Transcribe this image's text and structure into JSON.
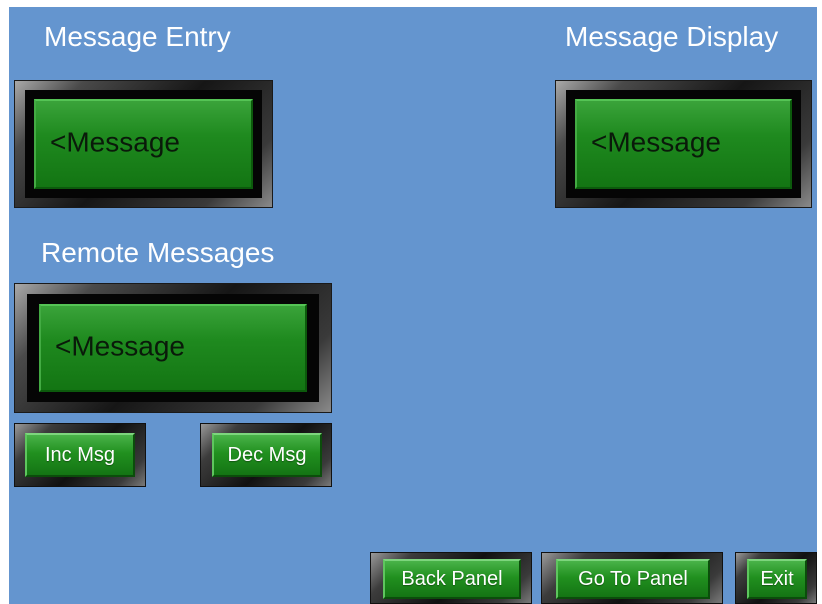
{
  "headings": {
    "message_entry": "Message Entry",
    "message_display": "Message Display",
    "remote_messages": "Remote Messages"
  },
  "displays": {
    "message_entry_value": "<Message",
    "message_display_value": "<Message",
    "remote_messages_value": "<Message"
  },
  "buttons": {
    "inc_msg": "Inc Msg",
    "dec_msg": "Dec Msg",
    "back_panel": "Back Panel",
    "go_to_panel": "Go To Panel",
    "exit": "Exit"
  },
  "colors": {
    "panel_background": "#6495cf",
    "lcd_green": "#1f8a1f",
    "button_green": "#21901f",
    "heading_text": "#ffffff"
  }
}
